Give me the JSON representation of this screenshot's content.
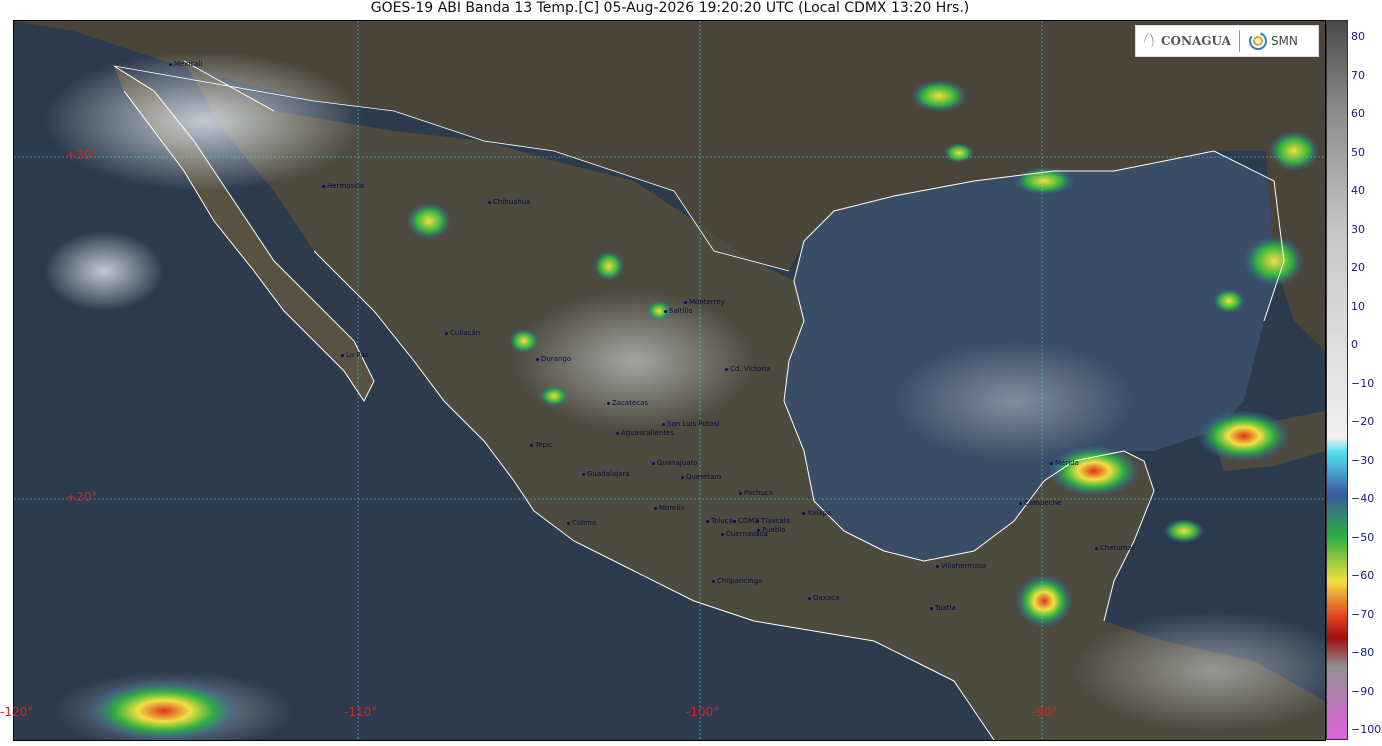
{
  "title": "GOES-19 ABI Banda 13 Temp.[C] 05-Aug-2026 19:20:20 UTC (Local CDMX  13:20 Hrs.)",
  "logo": {
    "left_text": "CONAGUA",
    "right_text": "SMN",
    "left_icon": "conagua-logo-icon",
    "right_icon": "smn-spiral-icon"
  },
  "grid_labels": {
    "lat30": "+30°",
    "lat20": "+20°",
    "lon120": "-120°",
    "lon110": "-110°",
    "lon100": "-100°",
    "lon90": "-90°"
  },
  "cities": [
    {
      "name": "Mexicali"
    },
    {
      "name": "Hermosillo"
    },
    {
      "name": "Chihuahua"
    },
    {
      "name": "Culiacán"
    },
    {
      "name": "La Paz"
    },
    {
      "name": "Durango"
    },
    {
      "name": "Monterrey"
    },
    {
      "name": "Saltillo"
    },
    {
      "name": "Cd. Victoria"
    },
    {
      "name": "Zacatecas"
    },
    {
      "name": "San Luis Potosí"
    },
    {
      "name": "Aguascalientes"
    },
    {
      "name": "Tepic"
    },
    {
      "name": "Guadalajara"
    },
    {
      "name": "Guanajuato"
    },
    {
      "name": "Querétaro"
    },
    {
      "name": "Pachuca"
    },
    {
      "name": "Xalapa"
    },
    {
      "name": "Colima"
    },
    {
      "name": "Morelia"
    },
    {
      "name": "Toluca"
    },
    {
      "name": "CDMX"
    },
    {
      "name": "Tlaxcala"
    },
    {
      "name": "Puebla"
    },
    {
      "name": "Cuernavaca"
    },
    {
      "name": "Chilpancingo"
    },
    {
      "name": "Oaxaca"
    },
    {
      "name": "Villahermosa"
    },
    {
      "name": "Tuxtla"
    },
    {
      "name": "Campeche"
    },
    {
      "name": "Mérida"
    },
    {
      "name": "Chetumal"
    }
  ],
  "colorbar": {
    "ticks": [
      "80",
      "70",
      "60",
      "50",
      "40",
      "30",
      "20",
      "10",
      "0",
      "−10",
      "−20",
      "−30",
      "−40",
      "−50",
      "−60",
      "−70",
      "−80",
      "−90",
      "−100"
    ],
    "max": 80,
    "min": -100,
    "colors": [
      "#4a4a4a",
      "#8a8a8a",
      "#c8c8c8",
      "#f0f0f0",
      "#55e0f0",
      "#3a5aa0",
      "#30b040",
      "#f0e040",
      "#e04020",
      "#a01010",
      "#909090",
      "#e060e0"
    ]
  }
}
